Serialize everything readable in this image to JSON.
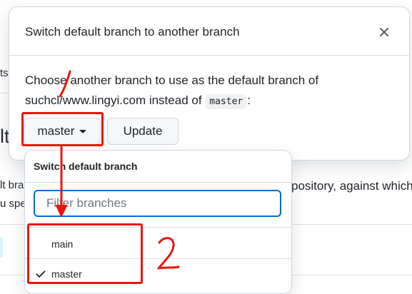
{
  "background": {
    "frag_ts": "ts",
    "frag_lt": "lt",
    "frag_lt_bra": "lt bra",
    "frag_u_spe": "u spe",
    "frag_repository": "pository, against which a"
  },
  "dialog": {
    "title": "Switch default branch to another branch",
    "description_prefix": "Choose another branch to use as the default branch of suchcl/www.lingyi.com instead of",
    "current_branch_code": "master",
    "description_suffix": ":",
    "branch_button_label": "master",
    "update_button_label": "Update"
  },
  "dropdown": {
    "title": "Switch default branch",
    "filter_placeholder": "Filter branches",
    "items": [
      {
        "label": "main",
        "selected": false
      },
      {
        "label": "master",
        "selected": true
      }
    ]
  },
  "annotations": {
    "step_two_label": "2",
    "color": "#e8170e"
  },
  "colors": {
    "focus_blue": "#0969da",
    "border": "#d0d7de",
    "button_bg": "#f6f8fa",
    "code_bg": "#eff1f3"
  }
}
